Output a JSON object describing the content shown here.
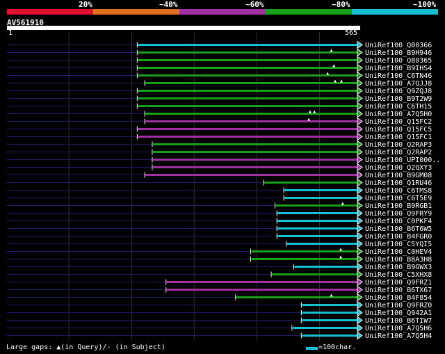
{
  "header": {
    "pct_labels": [
      "20%",
      "~40%",
      "~60%",
      "~80%",
      "~100%"
    ],
    "colors": [
      "#e01030",
      "#e07020",
      "#a030a0",
      "#18a018",
      "#16c0d0"
    ],
    "query_id": "AV561910",
    "axis_start": "1",
    "axis_end": "565"
  },
  "footer": {
    "gaps_text": "Large gaps: ▲(in Query)/- (in Subject)",
    "scale_text": "=100char."
  },
  "chart_data": {
    "type": "alignment",
    "x_range": [
      1,
      565
    ],
    "tier_colors": {
      "magenta": "#a030a0",
      "green": "#18a018",
      "cyan": "#16c0d0"
    },
    "hits": [
      {
        "label": "UniRef100_Q80366",
        "start": 209,
        "color": "cyan",
        "query_gaps": []
      },
      {
        "label": "UniRef100_B9H946",
        "start": 209,
        "color": "green",
        "query_gaps": [
          519
        ]
      },
      {
        "label": "UniRef100_Q80365",
        "start": 209,
        "color": "green",
        "query_gaps": []
      },
      {
        "label": "UniRef100_B9IHS4",
        "start": 209,
        "color": "green",
        "query_gaps": [
          523
        ]
      },
      {
        "label": "UniRef100_C6TN46",
        "start": 209,
        "color": "green",
        "query_gaps": [
          513
        ]
      },
      {
        "label": "UniRef100_A7QJJ8",
        "start": 221,
        "color": "green",
        "query_gaps": [
          525,
          535
        ]
      },
      {
        "label": "UniRef100_Q9ZQJ8",
        "start": 209,
        "color": "green",
        "query_gaps": []
      },
      {
        "label": "UniRef100_B9T2W9",
        "start": 209,
        "color": "green",
        "query_gaps": []
      },
      {
        "label": "UniRef100_C6TH15",
        "start": 209,
        "color": "green",
        "query_gaps": []
      },
      {
        "label": "UniRef100_A7Q5H0",
        "start": 221,
        "color": "green",
        "query_gaps": [
          485,
          492
        ]
      },
      {
        "label": "UniRef100_Q15FC2",
        "start": 221,
        "color": "magenta",
        "query_gaps": [
          483
        ]
      },
      {
        "label": "UniRef100_Q15FC5",
        "start": 209,
        "color": "magenta",
        "query_gaps": []
      },
      {
        "label": "UniRef100_Q15FC1",
        "start": 209,
        "color": "magenta",
        "query_gaps": []
      },
      {
        "label": "UniRef100_Q2RAP3",
        "start": 233,
        "color": "green",
        "query_gaps": []
      },
      {
        "label": "UniRef100_Q2RAP2",
        "start": 233,
        "color": "green",
        "query_gaps": []
      },
      {
        "label": "UniRef100_UPI000..",
        "start": 233,
        "color": "magenta",
        "query_gaps": []
      },
      {
        "label": "UniRef100_Q2QXY3",
        "start": 233,
        "color": "magenta",
        "query_gaps": []
      },
      {
        "label": "UniRef100_B9GM08",
        "start": 221,
        "color": "magenta",
        "query_gaps": []
      },
      {
        "label": "UniRef100_Q1RU46",
        "start": 411,
        "color": "green",
        "query_gaps": []
      },
      {
        "label": "UniRef100_C6TMS8",
        "start": 443,
        "color": "cyan",
        "query_gaps": []
      },
      {
        "label": "UniRef100_C6T5E9",
        "start": 443,
        "color": "cyan",
        "query_gaps": []
      },
      {
        "label": "UniRef100_B9RGB1",
        "start": 429,
        "color": "green",
        "query_gaps": [
          537
        ]
      },
      {
        "label": "UniRef100_Q9FRY9",
        "start": 432,
        "color": "cyan",
        "query_gaps": []
      },
      {
        "label": "UniRef100_C0PKF4",
        "start": 432,
        "color": "cyan",
        "query_gaps": []
      },
      {
        "label": "UniRef100_B6T6W5",
        "start": 432,
        "color": "cyan",
        "query_gaps": []
      },
      {
        "label": "UniRef100_B4FGR0",
        "start": 432,
        "color": "cyan",
        "query_gaps": []
      },
      {
        "label": "UniRef100_C5YQI5",
        "start": 447,
        "color": "cyan",
        "query_gaps": []
      },
      {
        "label": "UniRef100_C0HEV4",
        "start": 390,
        "color": "green",
        "query_gaps": [
          534
        ]
      },
      {
        "label": "UniRef100_B8A3H8",
        "start": 390,
        "color": "green",
        "query_gaps": [
          534
        ]
      },
      {
        "label": "UniRef100_B9GWX3",
        "start": 459,
        "color": "cyan",
        "query_gaps": []
      },
      {
        "label": "UniRef100_C5XHX8",
        "start": 423,
        "color": "green",
        "query_gaps": []
      },
      {
        "label": "UniRef100_Q9FRZ1",
        "start": 255,
        "color": "magenta",
        "query_gaps": []
      },
      {
        "label": "UniRef100_B6TX67",
        "start": 255,
        "color": "magenta",
        "query_gaps": []
      },
      {
        "label": "UniRef100_B4F854",
        "start": 366,
        "color": "green",
        "query_gaps": [
          519
        ]
      },
      {
        "label": "UniRef100_Q9FRZ0",
        "start": 471,
        "color": "cyan",
        "query_gaps": []
      },
      {
        "label": "UniRef100_Q942A1",
        "start": 471,
        "color": "cyan",
        "query_gaps": []
      },
      {
        "label": "UniRef100_B6TIW7",
        "start": 471,
        "color": "cyan",
        "query_gaps": []
      },
      {
        "label": "UniRef100_A7Q5H6",
        "start": 456,
        "color": "cyan",
        "query_gaps": []
      },
      {
        "label": "UniRef100_A7Q5H4",
        "start": 471,
        "color": "cyan",
        "query_gaps": []
      }
    ]
  }
}
